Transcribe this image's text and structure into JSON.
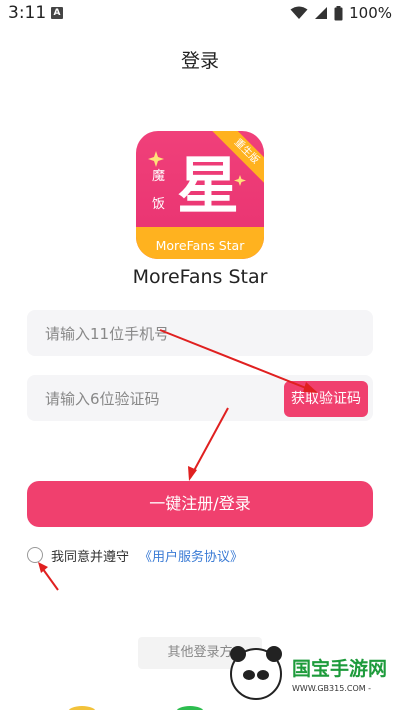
{
  "status_bar": {
    "time": "3:11",
    "badge": "A",
    "battery": "100%"
  },
  "header": {
    "title": "登录"
  },
  "app": {
    "name": "MoreFans Star",
    "logo": {
      "main_char": "星",
      "side_chars": [
        "魔",
        "饭"
      ],
      "ribbon": "重生版",
      "band_text": "MoreFans Star"
    }
  },
  "form": {
    "phone_placeholder": "请输入11位手机号",
    "code_placeholder": "请输入6位验证码",
    "get_code_label": "获取验证码",
    "submit_label": "一键注册/登录"
  },
  "agreement": {
    "text": "我同意并遵守",
    "link": "《用户服务协议》"
  },
  "other_login": {
    "label": "其他登录方"
  },
  "watermark": {
    "text": "国宝手游网",
    "url": "WWW.GB315.COM -"
  },
  "colors": {
    "accent": "#f0406e",
    "link": "#3a7bd5",
    "logo_band": "#ffb21f",
    "annotation_arrow": "#e02020"
  }
}
